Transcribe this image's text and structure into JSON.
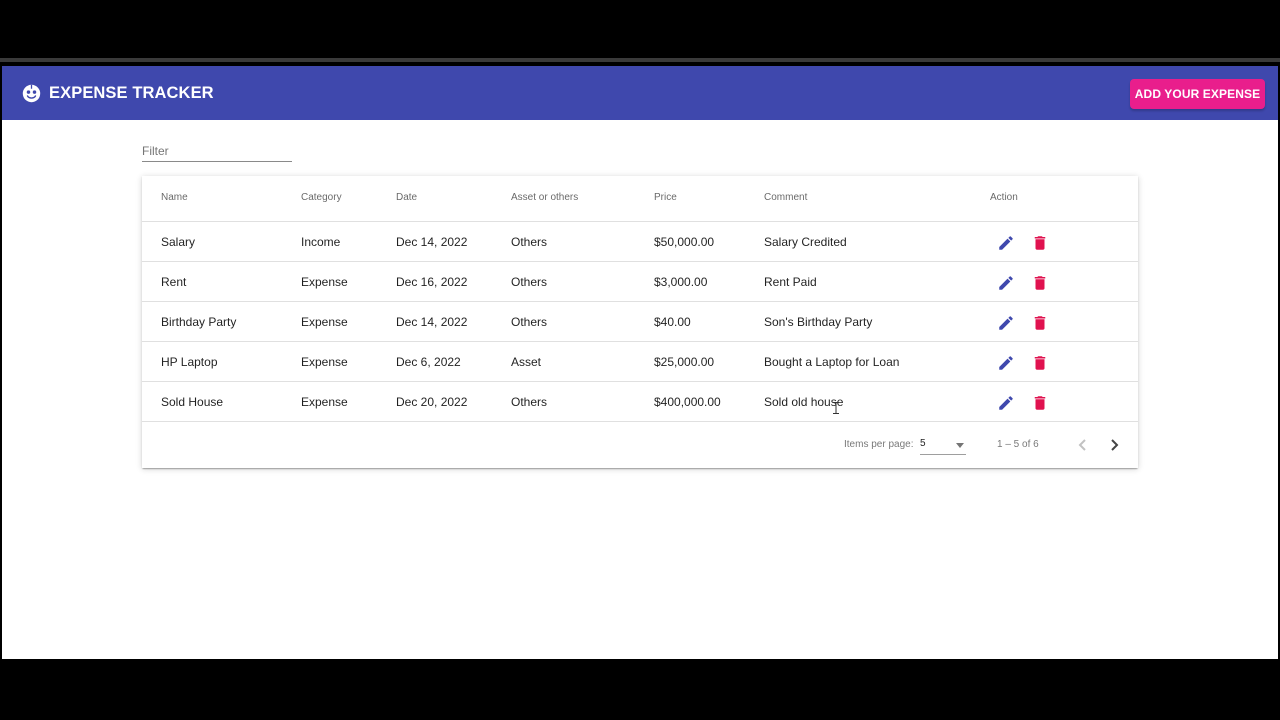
{
  "header": {
    "logo_icon": "face-icon",
    "title": "EXPENSE TRACKER",
    "add_button_label": "ADD YOUR EXPENSE"
  },
  "filter": {
    "placeholder": "Filter",
    "value": ""
  },
  "table": {
    "columns": [
      "Name",
      "Category",
      "Date",
      "Asset or others",
      "Price",
      "Comment",
      "Action"
    ],
    "rows": [
      {
        "name": "Salary",
        "category": "Income",
        "date": "Dec 14, 2022",
        "asset": "Others",
        "price": "$50,000.00",
        "comment": "Salary Credited"
      },
      {
        "name": "Rent",
        "category": "Expense",
        "date": "Dec 16, 2022",
        "asset": "Others",
        "price": "$3,000.00",
        "comment": "Rent Paid"
      },
      {
        "name": "Birthday Party",
        "category": "Expense",
        "date": "Dec 14, 2022",
        "asset": "Others",
        "price": "$40.00",
        "comment": "Son's Birthday Party"
      },
      {
        "name": "HP Laptop",
        "category": "Expense",
        "date": "Dec 6, 2022",
        "asset": "Asset",
        "price": "$25,000.00",
        "comment": "Bought a Laptop for Loan"
      },
      {
        "name": "Sold House",
        "category": "Expense",
        "date": "Dec 20, 2022",
        "asset": "Others",
        "price": "$400,000.00",
        "comment": "Sold old house"
      }
    ],
    "action_icons": [
      "edit-icon",
      "delete-icon"
    ]
  },
  "paginator": {
    "items_per_page_label": "Items per page:",
    "items_per_page_value": "5",
    "range_label": "1 – 5 of 6",
    "prev_icon": "chevron-left-icon",
    "next_icon": "chevron-right-icon"
  },
  "colors": {
    "primary": "#3f48ad",
    "accent": "#e91e8c",
    "edit_icon": "#3f48ad",
    "delete_icon": "#e0124f"
  }
}
